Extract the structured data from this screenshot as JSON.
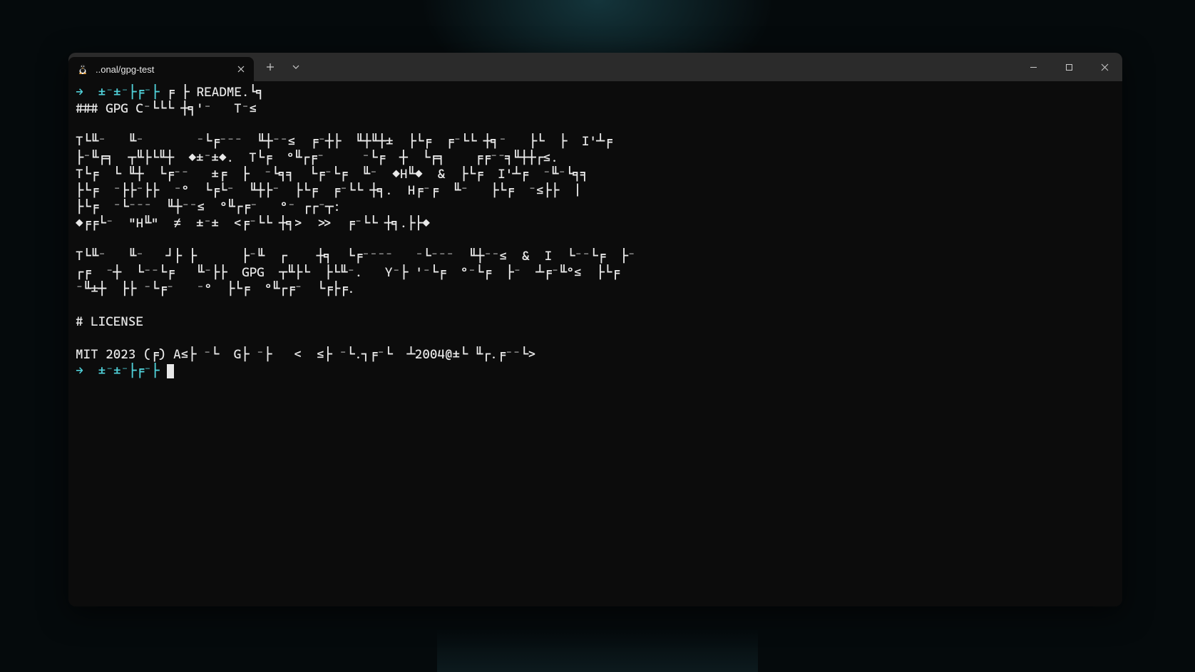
{
  "window": {
    "tab_title": "..onal/gpg-test",
    "icons": {
      "tab": "tux-icon",
      "close_tab": "close-icon",
      "new_tab": "plus-icon",
      "dropdown": "chevron-down-icon",
      "minimize": "minimize-icon",
      "maximize": "maximize-icon",
      "close_window": "close-icon"
    }
  },
  "prompt": {
    "arrow": "→",
    "path": "±⁻±⁻├╒⁻├",
    "command": "╒ ├ README.└╕"
  },
  "terminal_output": {
    "lines": [
      "### GPG C⁻└└└ ┼╕'⁻   T⁻≤",
      "",
      "T└╙⁻   ╙⁻       ⁻└╒⁻⁻⁻  ╙┼⁻⁻≤  ╒⁻┼├  ╙┼╙┼±  ├└╒  ╒⁻└└ ┼╕⁻   ├└  ├  I'┴╒",
      "├⁻╙╒╕  ┬╙├└╙┼  ◆±⁻±◆.  T└╒  º╙┌╒⁻     ⁻└╒  ┼  └╒╕    ╒╒⁻⁻╕╙┼┼┌≤.",
      "T└╒  └ ╙┼  └╒⁻⁻   ±╒  ├  ⁻└╕╕  └╒⁻└╒  ╙⁻  ◆H╙◆  &  ├└╒  I'┴╒  ⁻╙⁻└╕╕",
      "├└╒  ⁻├├⁻├├  ⁻º  └╒└⁻  ╙┼├⁻  ├└╒  ╒⁻└└ ┼╕.  H╒⁻╒  ╙⁻   ├└╒  ⁻≤├├  |",
      "├└╒  ⁻└⁻⁻⁻  ╙┼⁻⁻≤  º╙┌╒⁻   º⁻ ┌┌⁻┬:",
      "◆╒╒└⁻  \"H╙\"  ≠  ±⁻±  <╒⁻└└ ┼╕>  >>  ╒⁻└└ ┼╕.├├◆",
      "",
      "T└╙⁻   ╙⁻   ┘├ ├      ├⁻╙  ┌    ┼╕  └╒⁻⁻⁻⁻   ⁻└⁻⁻⁻  ╙┼⁻⁻≤  &  I  └⁻⁻└╒  ├⁻",
      "┌╒  ⁻┼  └⁻⁻└╒   ╙⁻├├  GPG  ┬╙├└  ├└╙⁻.   Y⁻├ '⁻└╒  º⁻└╒  ├⁻  ┴╒⁻╙º≤  ├└╒",
      "⁻╙±┼  ├├ ⁻└╒⁻   ⁻º  ├└╒  º╙┌╒⁻  └╒├╒.",
      "",
      "# LICENSE",
      "",
      "MIT 2023 (╒) A≤├ ⁻└  G├ ⁻├   <  ≤├ ⁻└.┐╒⁻└  ┴2004@±└ ╙┌.╒⁻⁻└>"
    ]
  },
  "prompt2": {
    "arrow": "→",
    "path": "±⁻±⁻├╒⁻├"
  },
  "colors": {
    "accent": "#50d0d8",
    "background": "#0c0c0c",
    "titlebar": "#2b2b2b",
    "text": "#e8e8e8"
  }
}
